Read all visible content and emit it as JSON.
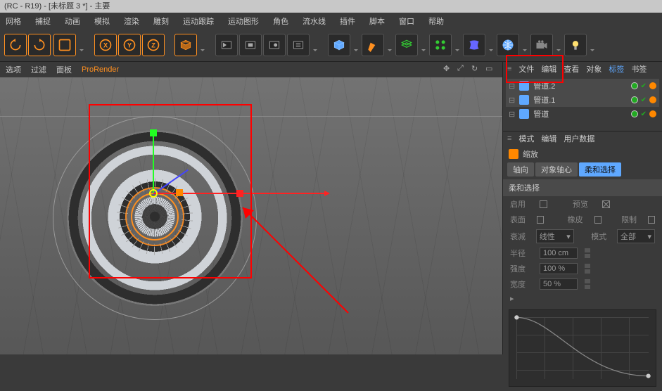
{
  "title": "(RC - R19) - [未标题 3 *] - 主要",
  "menu": [
    "网格",
    "捕捉",
    "动画",
    "模拟",
    "渲染",
    "雕刻",
    "运动跟踪",
    "运动图形",
    "角色",
    "流水线",
    "插件",
    "脚本",
    "窗口",
    "帮助"
  ],
  "viewport_tabs": {
    "t1": "选项",
    "t2": "过滤",
    "t3": "面板",
    "t4": "ProRender"
  },
  "right": {
    "tabs": [
      "文件",
      "编辑",
      "查看",
      "对象",
      "标签",
      "书签"
    ],
    "objects": [
      {
        "name": "管道.2",
        "selected": true
      },
      {
        "name": "管道.1",
        "selected": true
      },
      {
        "name": "管道",
        "selected": false
      }
    ]
  },
  "attrib": {
    "tabs": [
      "模式",
      "编辑",
      "用户数据"
    ],
    "title": "缩放",
    "subtabs": {
      "a": "轴向",
      "b": "对象轴心",
      "c": "柔和选择"
    },
    "section": "柔和选择",
    "rows": {
      "enable_lbl": "启用",
      "preview_lbl": "预览",
      "surface_lbl": "表面",
      "rubber_lbl": "橡皮",
      "limit_lbl": "限制",
      "falloff_lbl": "衰减",
      "falloff_val": "线性",
      "mode_lbl": "模式",
      "mode_val": "全部",
      "radius_lbl": "半径",
      "radius_val": "100 cm",
      "strength_lbl": "强度",
      "strength_val": "100 %",
      "width_lbl": "宽度",
      "width_val": "50 %"
    }
  }
}
